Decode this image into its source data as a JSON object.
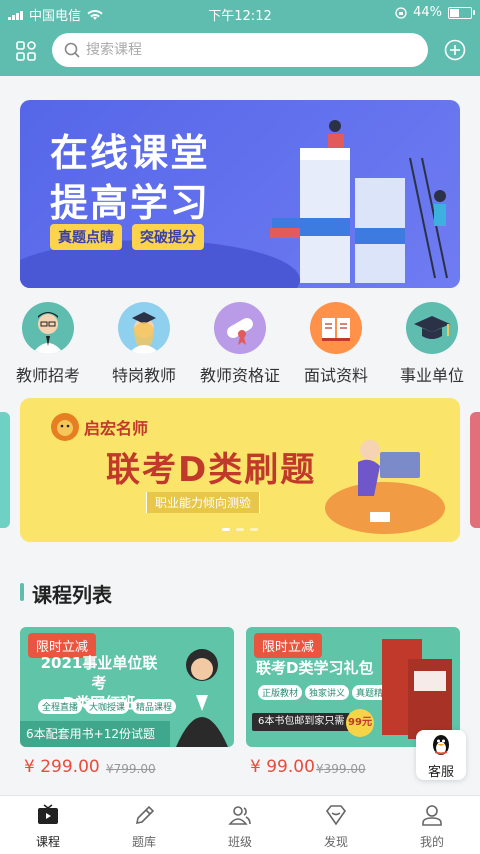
{
  "status_bar": {
    "carrier": "中国电信",
    "time": "下午12:12",
    "battery": "44%",
    "battery_level": 0.44
  },
  "header": {
    "search_placeholder": "搜索课程"
  },
  "banner": {
    "line1": "在线课堂",
    "line2": "提高学习",
    "pill1": "真题点睛",
    "pill2": "突破提分"
  },
  "categories": [
    {
      "label": "教师招考"
    },
    {
      "label": "特岗教师"
    },
    {
      "label": "教师资格证"
    },
    {
      "label": "面试资料"
    },
    {
      "label": "事业单位"
    }
  ],
  "promo": {
    "brand": "启宏名师",
    "title": "联考D类刷题",
    "subtitle": "职业能力倾向测验"
  },
  "section": {
    "title": "课程列表"
  },
  "courses": [
    {
      "badge": "限时立减",
      "title_line1": "2021事业单位联考",
      "title_line2": "D类网红班",
      "tags": [
        "全程直播",
        "大咖授课",
        "精品课程"
      ],
      "note": "6本配套用书+12份试题",
      "price": "¥ 299.00",
      "original_price": "¥799.00"
    },
    {
      "badge": "限时立减",
      "title_line1": "联考D类学习礼包",
      "tags": [
        "正版教材",
        "独家讲义",
        "真题精选"
      ],
      "note": "6本书包邮到家只需",
      "deal": "99元",
      "price": "¥ 99.00",
      "original_price": "¥399.00"
    }
  ],
  "customer_service": {
    "label": "客服"
  },
  "tabbar": [
    {
      "label": "课程",
      "active": true
    },
    {
      "label": "题库",
      "active": false
    },
    {
      "label": "班级",
      "active": false
    },
    {
      "label": "发现",
      "active": false
    },
    {
      "label": "我的",
      "active": false
    }
  ],
  "colors": {
    "theme": "#5fbdb0",
    "price": "#e74c3c",
    "banner": "#5566e8"
  }
}
